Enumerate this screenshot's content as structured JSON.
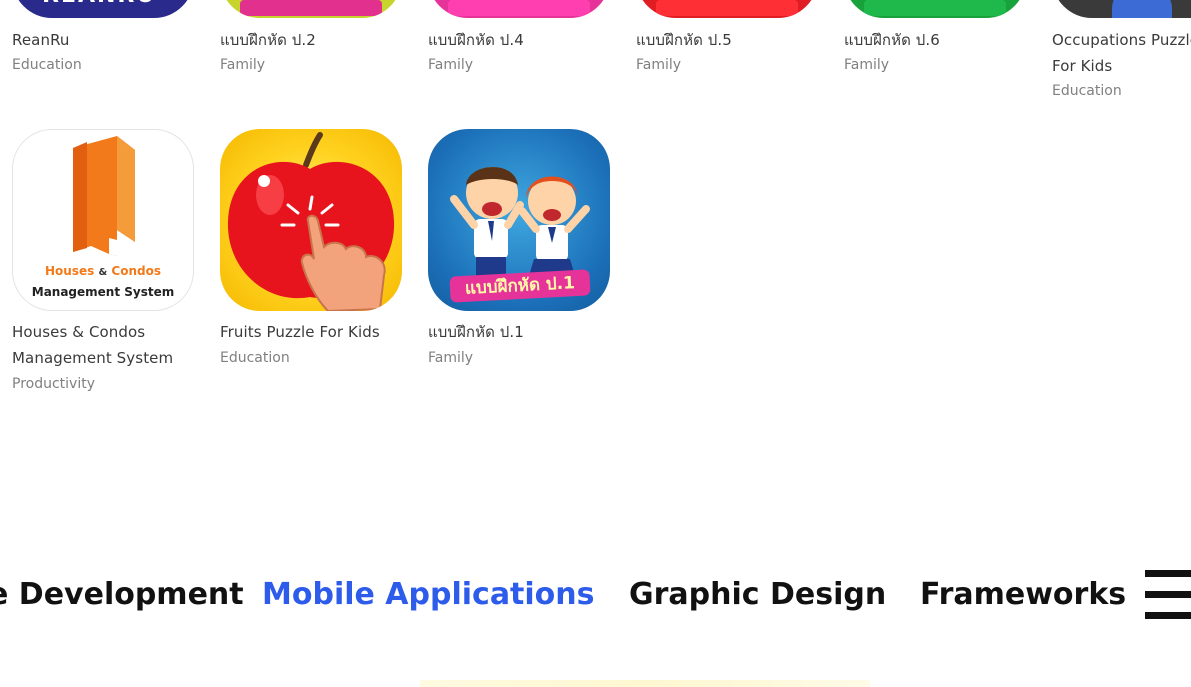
{
  "apps_top_row": [
    {
      "name": "ReanRu",
      "category": "Education",
      "icon_color": "#2a2a8c"
    },
    {
      "name": "แบบฝึกหัด ป.2",
      "category": "Family",
      "icon_color": "#c6d42b"
    },
    {
      "name": "แบบฝึกหัด ป.4",
      "category": "Family",
      "icon_color": "#e6339a"
    },
    {
      "name": "แบบฝึกหัด ป.5",
      "category": "Family",
      "icon_color": "#e11d24"
    },
    {
      "name": "แบบฝึกหัด ป.6",
      "category": "Family",
      "icon_color": "#17a23c"
    },
    {
      "name": "Occupations Puzzle",
      "name_line2": "For Kids",
      "category": "Education",
      "icon_color": "#3a3a3a"
    }
  ],
  "apps_second_row": [
    {
      "name": "Houses & Condos",
      "name_line2": "Management System",
      "category": "Productivity",
      "icon_text_line1_a": "Houses",
      "icon_text_line1_amp": "&",
      "icon_text_line1_b": "Condos",
      "icon_text_line2": "Management System"
    },
    {
      "name": "Fruits Puzzle For Kids",
      "category": "Education"
    },
    {
      "name": "แบบฝึกหัด ป.1",
      "category": "Family",
      "icon_text": "แบบฝึกหัด ป.1"
    }
  ],
  "nav": {
    "items": [
      "e Development",
      "Mobile Applications",
      "Graphic Design",
      "Frameworks"
    ],
    "active": "Mobile Applications"
  },
  "colors": {
    "accent": "#2d5bea",
    "category_text": "#808080",
    "name_text": "#3a3a3a"
  }
}
